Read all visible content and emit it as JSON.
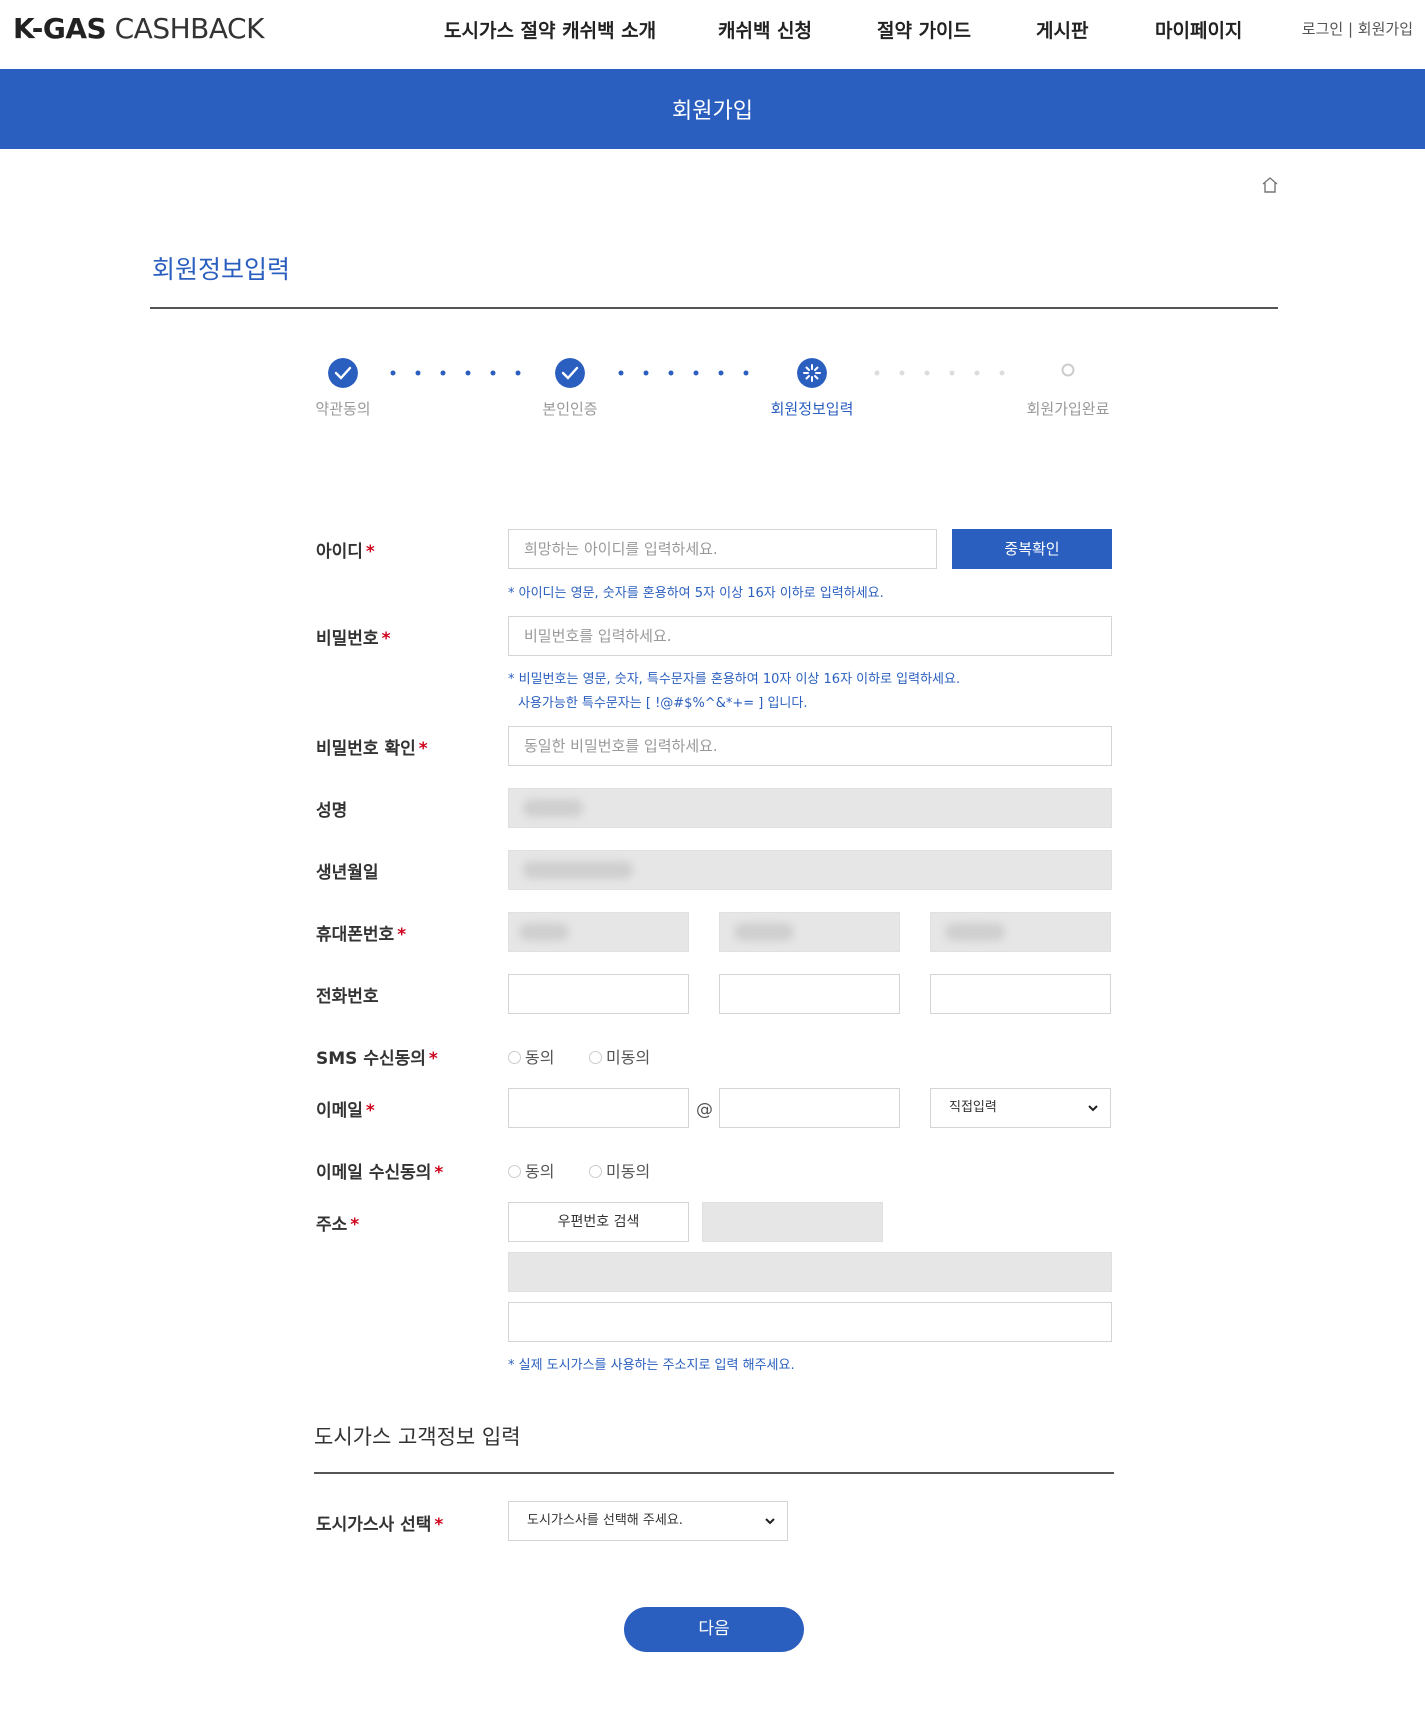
{
  "header": {
    "logo_bold": "K-GAS",
    "logo_light": "CASHBACK",
    "nav": [
      {
        "label": "도시가스 절약 캐쉬백 소개"
      },
      {
        "label": "캐쉬백 신청"
      },
      {
        "label": "절약 가이드"
      },
      {
        "label": "게시판"
      },
      {
        "label": "마이페이지"
      }
    ],
    "login_label": "로그인",
    "separator": "|",
    "signup_label": "회원가입"
  },
  "banner": {
    "title": "회원가입"
  },
  "breadcrumb": {
    "home_icon": "home-icon"
  },
  "section": {
    "title": "회원정보입력"
  },
  "steps": [
    {
      "label": "약관동의",
      "status": "done"
    },
    {
      "label": "본인인증",
      "status": "done"
    },
    {
      "label": "회원정보입력",
      "status": "current"
    },
    {
      "label": "회원가입완료",
      "status": "pending"
    }
  ],
  "form": {
    "required_mark": "*",
    "id": {
      "label": "아이디",
      "placeholder": "희망하는 아이디를 입력하세요.",
      "button": "중복확인",
      "hint": "* 아이디는 영문, 숫자를 혼용하여 5자 이상 16자 이하로 입력하세요."
    },
    "password": {
      "label": "비밀번호",
      "placeholder": "비밀번호를 입력하세요.",
      "hint1": "* 비밀번호는 영문, 숫자, 특수문자를 혼용하여 10자 이상 16자 이하로 입력하세요.",
      "hint2": "사용가능한 특수문자는 [ !@#$%^&*+= ] 입니다."
    },
    "password_confirm": {
      "label": "비밀번호 확인",
      "placeholder": "동일한 비밀번호를 입력하세요."
    },
    "name": {
      "label": "성명"
    },
    "birth": {
      "label": "생년월일"
    },
    "mobile": {
      "label": "휴대폰번호"
    },
    "phone": {
      "label": "전화번호"
    },
    "sms_agree": {
      "label": "SMS 수신동의",
      "options": [
        "동의",
        "미동의"
      ]
    },
    "email": {
      "label": "이메일",
      "at": "@",
      "domain_select": "직접입력"
    },
    "email_agree": {
      "label": "이메일 수신동의",
      "options": [
        "동의",
        "미동의"
      ]
    },
    "address": {
      "label": "주소",
      "zip_button": "우편번호 검색",
      "hint": "* 실제 도시가스를 사용하는 주소지로 입력 해주세요."
    }
  },
  "gas_section": {
    "title": "도시가스 고객정보 입력",
    "company": {
      "label": "도시가스사 선택",
      "select": "도시가스사를 선택해 주세요."
    }
  },
  "next_button": "다음",
  "colors": {
    "accent": "#2a5fbf",
    "required": "#d0021b",
    "disabled": "#e6e6e6"
  }
}
